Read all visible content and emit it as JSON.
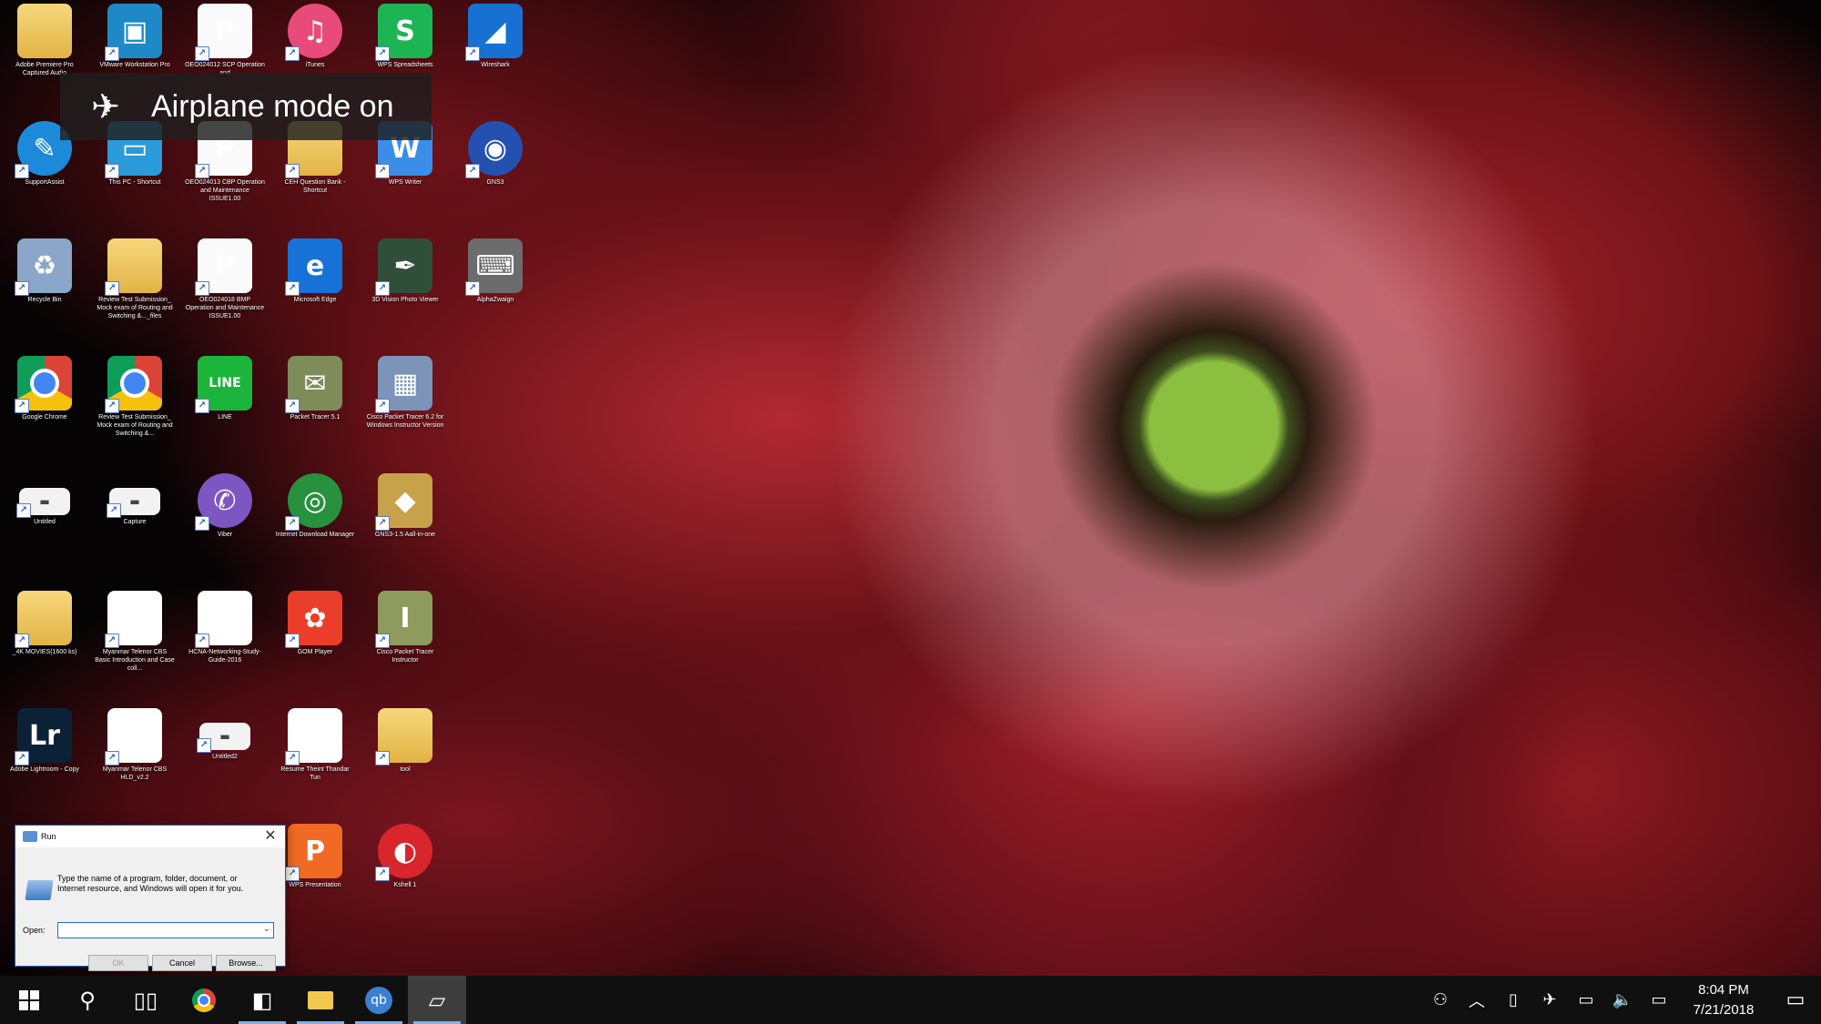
{
  "desktop": {
    "icons": [
      {
        "label": "Adobe Premiere Pro Captured Audio",
        "glyph": "",
        "kind": "folder"
      },
      {
        "label": "VMware Workstation Pro",
        "glyph": "▣",
        "kind": "app",
        "color": "#1d8ac7"
      },
      {
        "label": "OEO024012 SCP Operation and",
        "glyph": "P",
        "kind": "sheet"
      },
      {
        "label": "iTunes",
        "glyph": "♫",
        "kind": "round",
        "color": "#e84a7a"
      },
      {
        "label": "WPS Spreadsheets",
        "glyph": "S",
        "kind": "app",
        "color": "#1db554"
      },
      {
        "label": "Wireshark",
        "glyph": "◢",
        "kind": "app",
        "color": "#1671d2"
      },
      {
        "label": "SupportAssist",
        "glyph": "✎",
        "kind": "round",
        "color": "#1c8ad8"
      },
      {
        "label": "This PC - Shortcut",
        "glyph": "▭",
        "kind": "app",
        "color": "#2a9ad8"
      },
      {
        "label": "OEO024013 CBP Operation and Maintenance ISSUE1.00",
        "glyph": "P",
        "kind": "sheet"
      },
      {
        "label": "CEH Question Bank - Shortcut",
        "glyph": "",
        "kind": "folder"
      },
      {
        "label": "WPS Writer",
        "glyph": "W",
        "kind": "app",
        "color": "#3b8ee8"
      },
      {
        "label": "GNS3",
        "glyph": "◉",
        "kind": "round",
        "color": "#2451b0"
      },
      {
        "label": "Recycle Bin",
        "glyph": "♻",
        "kind": "app",
        "color": "#8aa6c8"
      },
      {
        "label": "Review Test Submission_ Mock exam of Routing and Switching &..._files",
        "glyph": "",
        "kind": "folder"
      },
      {
        "label": "OEO024018 BMP Operation and Maintenance ISSUE1.00",
        "glyph": "P",
        "kind": "sheet"
      },
      {
        "label": "Microsoft Edge",
        "glyph": "e",
        "kind": "app",
        "color": "#1672d6"
      },
      {
        "label": "3D Vision Photo Viewer",
        "glyph": "✒",
        "kind": "app",
        "color": "#2f4f3b"
      },
      {
        "label": "AlphaZwaign",
        "glyph": "⌨",
        "kind": "app",
        "color": "#6c6c6c"
      },
      {
        "label": "Google Chrome",
        "glyph": "",
        "kind": "chrome"
      },
      {
        "label": "Review Test Submission_ Mock exam of Routing and Switching &...",
        "glyph": "",
        "kind": "chrome"
      },
      {
        "label": "LINE",
        "glyph": "LINE",
        "kind": "app",
        "color": "#1bb53c"
      },
      {
        "label": "Packet Tracer 5.1",
        "glyph": "✉",
        "kind": "app",
        "color": "#7d8c58"
      },
      {
        "label": "Cisco Packet Tracer 6.2 for Windows Instructor Version",
        "glyph": "▦",
        "kind": "app",
        "color": "#7b94b8"
      },
      {
        "label": "Untitled",
        "glyph": "▬",
        "kind": "thumb"
      },
      {
        "label": "Capture",
        "glyph": "▬",
        "kind": "thumb"
      },
      {
        "label": "Viber",
        "glyph": "✆",
        "kind": "round",
        "color": "#7e56c2"
      },
      {
        "label": "Internet Download Manager",
        "glyph": "◎",
        "kind": "round",
        "color": "#27913d"
      },
      {
        "label": "GNS3-1.5 Aall-in-one",
        "glyph": "◆",
        "kind": "app",
        "color": "#c7a24a"
      },
      {
        "label": "_4K MOVIES(1600 ks)",
        "glyph": "",
        "kind": "folder"
      },
      {
        "label": "Myanmar Telenor CBS Basic Introduction and Case coll...",
        "glyph": "W",
        "kind": "doc"
      },
      {
        "label": "HCNA-Networking-Study-Guide-2016",
        "glyph": "pdf",
        "kind": "doc"
      },
      {
        "label": "GOM Player",
        "glyph": "✿",
        "kind": "app",
        "color": "#ea3e2b"
      },
      {
        "label": "Cisco Packet Tracer Instructor",
        "glyph": "I",
        "kind": "app",
        "color": "#8d9b5e"
      },
      {
        "label": "Adobe Lightroom - Copy",
        "glyph": "Lr",
        "kind": "app",
        "color": "#0b2236"
      },
      {
        "label": "Myanmar Telenor CBS HLD_v2.2",
        "glyph": "W",
        "kind": "doc"
      },
      {
        "label": "Untitled2",
        "glyph": "▬",
        "kind": "thumb"
      },
      {
        "label": "Resume Theint Thandar Tun",
        "glyph": "W",
        "kind": "doc"
      },
      {
        "label": "tool",
        "glyph": "",
        "kind": "folder"
      },
      {
        "label": "WPS Presentation",
        "glyph": "P",
        "kind": "app",
        "color": "#f06a24"
      },
      {
        "label": "Kshell 1",
        "glyph": "◐",
        "kind": "round",
        "color": "#d8262c"
      }
    ]
  },
  "toast": {
    "icon": "airplane-icon",
    "text": "Airplane mode on"
  },
  "run_dialog": {
    "title": "Run",
    "description": "Type the name of a program, folder, document, or Internet resource, and Windows will open it for you.",
    "open_label": "Open:",
    "open_value": "",
    "ok_label": "OK",
    "cancel_label": "Cancel",
    "browse_label": "Browse..."
  },
  "taskbar": {
    "clock_time": "8:04 PM",
    "clock_date": "7/21/2018",
    "pinned": [
      {
        "name": "start-button",
        "glyph": "win"
      },
      {
        "name": "search-icon",
        "glyph": "⚲"
      },
      {
        "name": "task-view-icon",
        "glyph": "▯▯"
      },
      {
        "name": "chrome-taskbar-icon",
        "glyph": "chrome"
      },
      {
        "name": "sticky-notes-icon",
        "glyph": "◧"
      },
      {
        "name": "file-explorer-icon",
        "glyph": "▬"
      },
      {
        "name": "qbittorrent-icon",
        "glyph": "qb"
      },
      {
        "name": "run-taskbar-icon",
        "glyph": "▱"
      }
    ],
    "tray": [
      {
        "name": "people-icon",
        "glyph": "⚇"
      },
      {
        "name": "show-hidden-icons-icon",
        "glyph": "︿"
      },
      {
        "name": "usb-icon",
        "glyph": "▯"
      },
      {
        "name": "airplane-mode-icon",
        "glyph": "✈"
      },
      {
        "name": "battery-icon",
        "glyph": "▭"
      },
      {
        "name": "volume-icon",
        "glyph": "🔈"
      },
      {
        "name": "input-indicator-icon",
        "glyph": "▭"
      }
    ]
  }
}
